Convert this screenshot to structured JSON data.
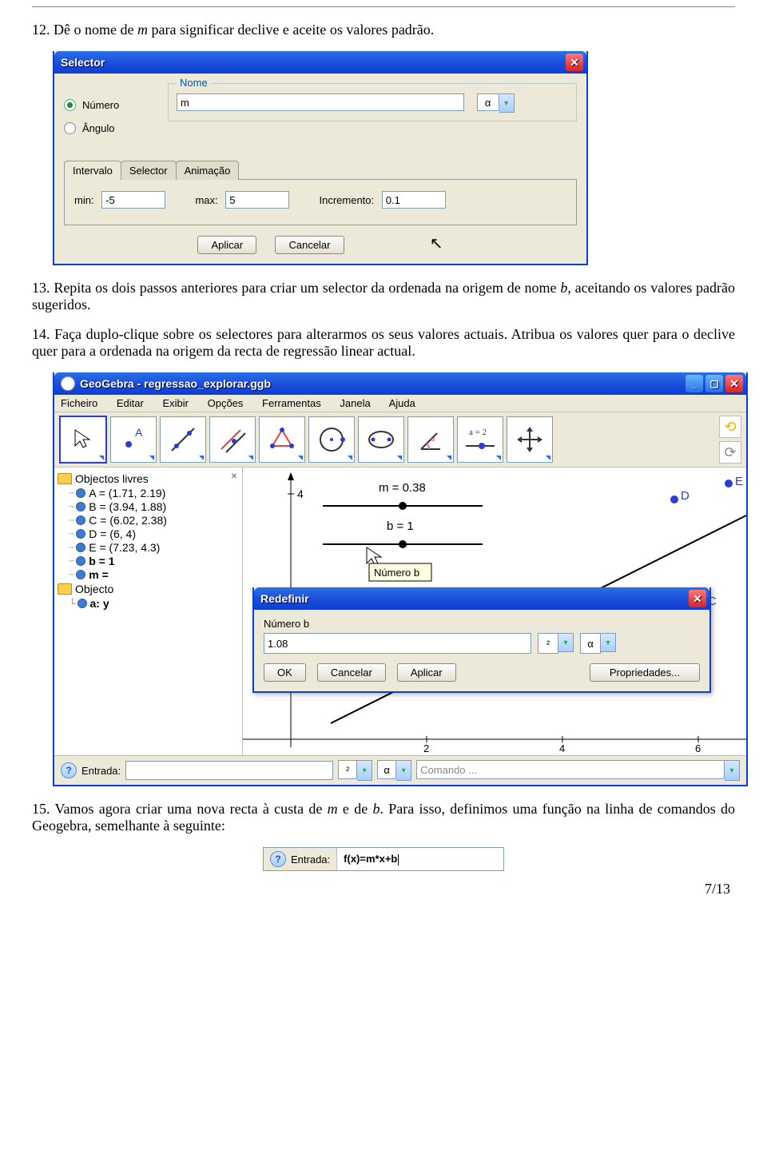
{
  "steps": {
    "s12_prefix": "12. Dê o nome de ",
    "s12_var": "m",
    "s12_suffix": " para significar declive e aceite os valores padrão.",
    "s13_prefix": "13. Repita os dois passos anteriores para criar um selector da ordenada na origem de nome ",
    "s13_var": "b",
    "s13_suffix": ", aceitando os valores padrão sugeridos.",
    "s14": "14. Faça duplo-clique sobre os selectores para alterarmos os seus valores actuais. Atribua os valores quer para o declive quer para a ordenada na origem da recta de regressão linear actual.",
    "s15_prefix": "15. Vamos agora criar uma nova recta à custa de ",
    "s15_var1": "m",
    "s15_mid": " e de ",
    "s15_var2": "b",
    "s15_suffix": ". Para isso, definimos uma função na linha de comandos do Geogebra, semelhante à seguinte:"
  },
  "selector_dialog": {
    "title": "Selector",
    "radio_numero": "Número",
    "radio_angulo": "Ângulo",
    "legend_nome": "Nome",
    "name_value": "m",
    "alpha": "α",
    "tabs": {
      "intervalo": "Intervalo",
      "selector": "Selector",
      "animacao": "Animação"
    },
    "min_label": "min:",
    "min_value": "-5",
    "max_label": "max:",
    "max_value": "5",
    "incr_label": "Incremento:",
    "incr_value": "0.1",
    "btn_aplicar": "Aplicar",
    "btn_cancelar": "Cancelar"
  },
  "ggb": {
    "title": "GeoGebra - regressao_explorar.ggb",
    "menu": [
      "Ficheiro",
      "Editar",
      "Exibir",
      "Opções",
      "Ferramentas",
      "Janela",
      "Ajuda"
    ],
    "tool_A": "A",
    "tool_slider": "a = 2",
    "algebra": {
      "free": "Objectos livres",
      "A": "A = (1.71, 2.19)",
      "B": "B = (3.94, 1.88)",
      "C": "C = (6.02, 2.38)",
      "D": "D = (6, 4)",
      "E": "E = (7.23, 4.3)",
      "b": "b = 1",
      "m": "m = ",
      "dep": "Objecto",
      "a": "a: y"
    },
    "graphics": {
      "m_label": "m = 0.38",
      "b_label": "b = 1",
      "tooltip": "Número b",
      "D": "D",
      "E": "E",
      "C": "C",
      "tick4": "4",
      "axis2": "2",
      "axis4": "4",
      "axis6": "6"
    },
    "redef": {
      "title": "Redefinir",
      "label": "Número b",
      "value": "1.08",
      "sq": "²",
      "alpha": "α",
      "ok": "OK",
      "cancel": "Cancelar",
      "apply": "Aplicar",
      "props": "Propriedades..."
    },
    "bottom": {
      "entrada": "Entrada:",
      "sq": "²",
      "alpha": "α",
      "comando": "Comando ..."
    }
  },
  "snippet": {
    "entrada": "Entrada:",
    "value": "f(x)=m*x+b"
  },
  "pagenum": "7/13"
}
